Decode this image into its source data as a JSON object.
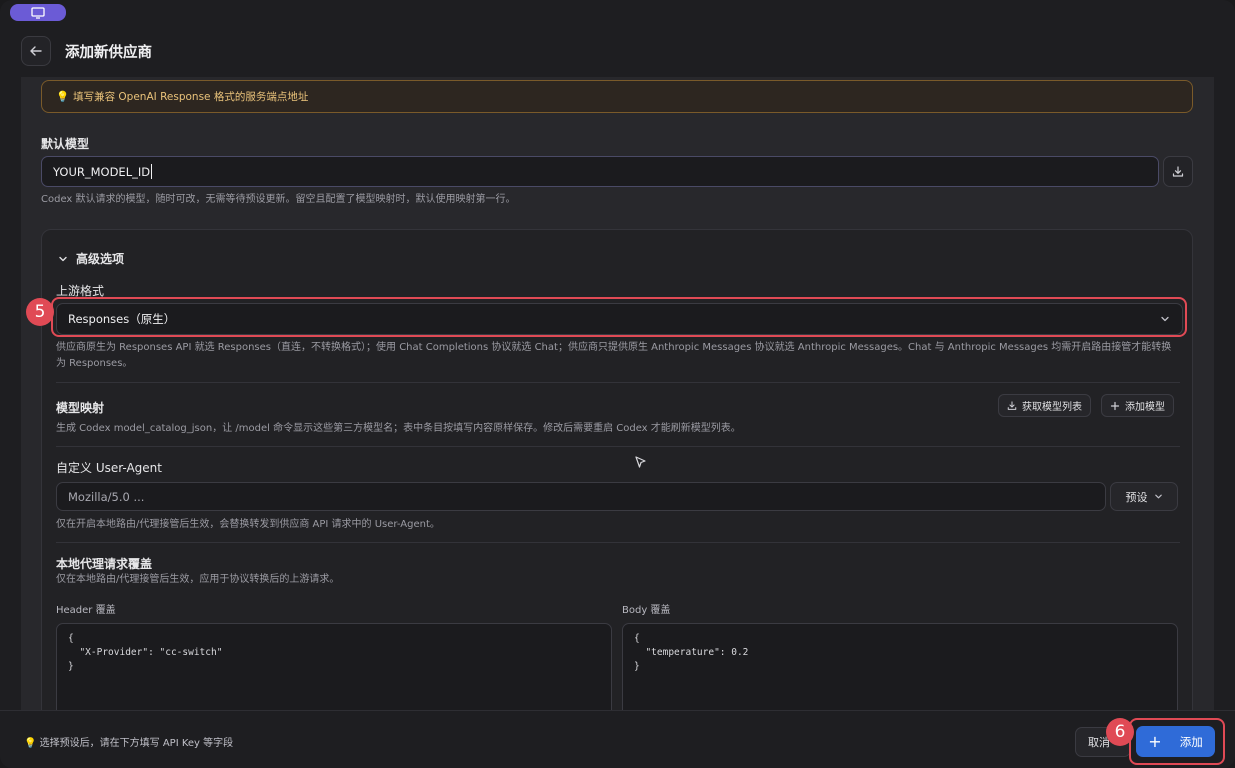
{
  "header": {
    "title": "添加新供应商"
  },
  "tip_banner": {
    "icon": "lightbulb-icon",
    "text": "填写兼容 OpenAI Response 格式的服务端点地址"
  },
  "default_model": {
    "label": "默认模型",
    "value": "YOUR_MODEL_ID",
    "help": "Codex 默认请求的模型，随时可改，无需等待预设更新。留空且配置了模型映射时，默认使用映射第一行。"
  },
  "advanced": {
    "toggle_label": "高级选项",
    "upstream_format": {
      "label": "上游格式",
      "selected": "Responses（原生）",
      "help": "供应商原生为 Responses API 就选 Responses（直连，不转换格式）；使用 Chat Completions 协议就选 Chat；供应商只提供原生 Anthropic Messages 协议就选 Anthropic Messages。Chat 与 Anthropic Messages 均需开启路由接管才能转换为 Responses。"
    },
    "model_mapping": {
      "label": "模型映射",
      "fetch_button": "获取模型列表",
      "add_button": "添加模型",
      "help": "生成 Codex model_catalog_json，让 /model 命令显示这些第三方模型名；表中条目按填写内容原样保存。修改后需要重启 Codex 才能刷新模型列表。"
    },
    "user_agent": {
      "label": "自定义 User-Agent",
      "placeholder": "Mozilla/5.0 ...",
      "preset_button": "预设",
      "help": "仅在开启本地路由/代理接管后生效，会替换转发到供应商 API 请求中的 User-Agent。"
    },
    "proxy_override": {
      "label": "本地代理请求覆盖",
      "help": "仅在本地路由/代理接管后生效，应用于协议转换后的上游请求。",
      "header_label": "Header 覆盖",
      "header_value": "{\n  \"X-Provider\": \"cc-switch\"\n}",
      "body_label": "Body 覆盖",
      "body_value": "{\n  \"temperature\": 0.2\n}"
    }
  },
  "footer": {
    "hint": "选择预设后，请在下方填写 API Key 等字段",
    "cancel_label": "取消",
    "add_label": "添加"
  },
  "annotations": {
    "step5": "5",
    "step6": "6",
    "highlight_color": "#e04a55"
  },
  "colors": {
    "primary": "#2f6bd8",
    "warning_text": "#e9c27a",
    "warning_border": "#7a5a2a"
  }
}
